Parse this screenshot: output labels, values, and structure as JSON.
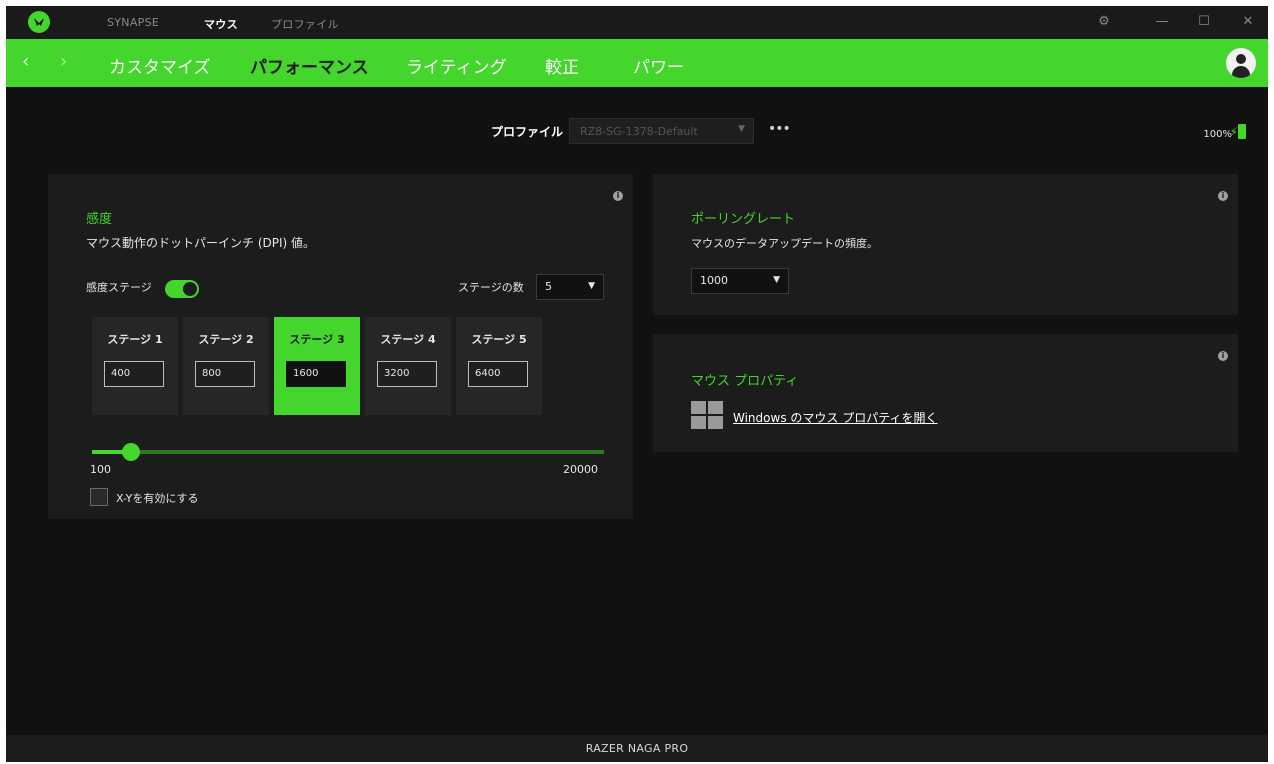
{
  "titlebar": {
    "tabs": [
      {
        "label": "SYNAPSE",
        "active": false
      },
      {
        "label": "マウス",
        "active": true
      },
      {
        "label": "プロファイル",
        "active": false
      }
    ]
  },
  "navbar": {
    "tabs": [
      {
        "label": "カスタマイズ",
        "active": false
      },
      {
        "label": "パフォーマンス",
        "active": true
      },
      {
        "label": "ライティング",
        "active": false
      },
      {
        "label": "較正",
        "active": false
      },
      {
        "label": "パワー",
        "active": false
      }
    ]
  },
  "profile": {
    "label": "プロファイル",
    "value": "RZ8-SG-1378-Default",
    "more": "•••"
  },
  "battery": {
    "percent": "100%"
  },
  "sensitivity": {
    "title": "感度",
    "description": "マウス動作のドットパーインチ (DPI) 値。",
    "stages_label": "感度ステージ",
    "stages_enabled": true,
    "stage_count_label": "ステージの数",
    "stage_count": "5",
    "stages": [
      {
        "label": "ステージ 1",
        "value": "400",
        "active": false
      },
      {
        "label": "ステージ 2",
        "value": "800",
        "active": false
      },
      {
        "label": "ステージ 3",
        "value": "1600",
        "active": true
      },
      {
        "label": "ステージ 4",
        "value": "3200",
        "active": false
      },
      {
        "label": "ステージ 5",
        "value": "6400",
        "active": false
      }
    ],
    "slider": {
      "min": "100",
      "max": "20000",
      "value": 1600
    },
    "xy_label": "X-Yを有効にする",
    "xy_enabled": false
  },
  "polling": {
    "title": "ポーリングレート",
    "description": "マウスのデータアップデートの頻度。",
    "value": "1000"
  },
  "mouse_properties": {
    "title": "マウス プロパティ",
    "link": "Windows のマウス プロパティを開く"
  },
  "footer": {
    "device": "RAZER NAGA PRO"
  },
  "colors": {
    "accent": "#44d62c",
    "background": "#111111",
    "panel": "#1c1c1c"
  }
}
